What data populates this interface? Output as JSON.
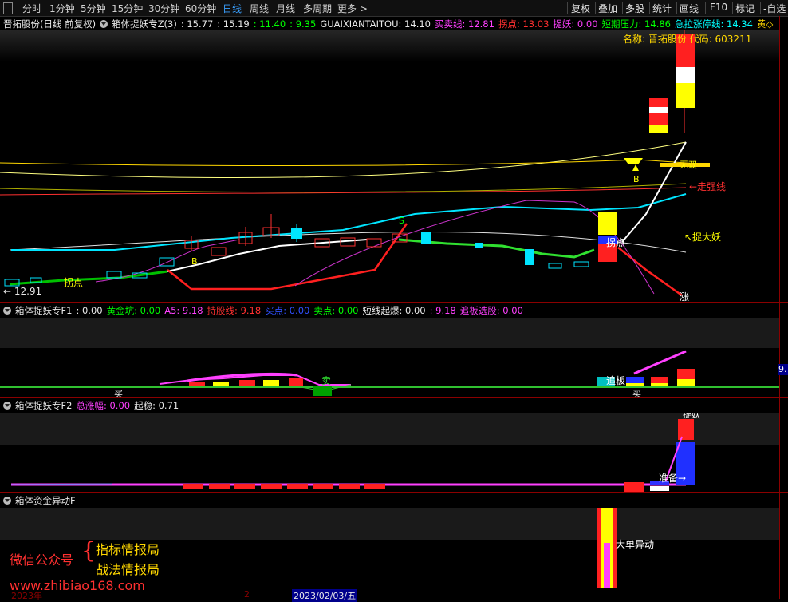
{
  "toolbar": {
    "periods": [
      "分时",
      "1分钟",
      "5分钟",
      "15分钟",
      "30分钟",
      "60分钟",
      "日线",
      "周线",
      "月线",
      "多周期",
      "更多"
    ],
    "active_period": "日线",
    "right_buttons": [
      "复权",
      "叠加",
      "多股",
      "统计",
      "画线",
      "F10",
      "标记",
      "-自选"
    ]
  },
  "main_legend": {
    "stock": "晋拓股份(日线 前复权)",
    "indicator": "箱体捉妖专Z(3)",
    "values": [
      {
        "label": "",
        "value": ": 15.77",
        "color": "#e8e8e8"
      },
      {
        "label": "",
        "value": ": 15.19",
        "color": "#e8e8e8"
      },
      {
        "label": "",
        "value": ": 11.40",
        "color": "#00ff00"
      },
      {
        "label": "",
        "value": ": 9.35",
        "color": "#00ff00"
      },
      {
        "label": "GUAIXIANTAITOU",
        "value": ": 14.10",
        "color": "#e8e8e8"
      },
      {
        "label": "买卖线",
        "value": ": 12.81",
        "color": "#ff40ff"
      },
      {
        "label": "拐点",
        "value": ": 13.03",
        "color": "#ff3030"
      },
      {
        "label": "捉妖",
        "value": ": 0.00",
        "color": "#ff40ff"
      },
      {
        "label": "短期压力",
        "value": ": 14.86",
        "color": "#00ff00"
      },
      {
        "label": "急拉涨停线",
        "value": ": 14.34",
        "color": "#00ffff"
      },
      {
        "label": "黄",
        "value": "◇",
        "color": "#ffd700"
      }
    ]
  },
  "main_chart": {
    "name_label": "名称: 晋拓股份 代码: 603211",
    "low_price": "12.91",
    "annotations": {
      "guaidian_left": "拐点",
      "B_left": "B",
      "S_mid": "S",
      "guaidian_right": "拐点",
      "B_right": "B",
      "zouqiang": "←走强线",
      "zhuoyao": "↖捉大妖",
      "zhang": "涨",
      "wushuang": "无双"
    }
  },
  "f1_legend": {
    "title": "箱体捉妖专F1",
    "values": [
      {
        "label": "",
        "value": ": 0.00",
        "color": "#e8e8e8"
      },
      {
        "label": "黄金坑",
        "value": ": 0.00",
        "color": "#00ff00"
      },
      {
        "label": "A5",
        "value": ": 9.18",
        "color": "#ff40ff"
      },
      {
        "label": "持股线",
        "value": ": 9.18",
        "color": "#ff3030"
      },
      {
        "label": "买点",
        "value": ": 0.00",
        "color": "#3050ff"
      },
      {
        "label": "卖点",
        "value": ": 0.00",
        "color": "#00ff00"
      },
      {
        "label": "短线起爆",
        "value": ": 0.00",
        "color": "#e8e8e8"
      },
      {
        "label": "",
        "value": ": 9.18",
        "color": "#ff40ff"
      },
      {
        "label": "追板选股",
        "value": ": 0.00",
        "color": "#ff40ff"
      }
    ],
    "labels": {
      "buy_left": "买",
      "sell_mid": "卖",
      "zhuiban": "追板",
      "buy_right": "买",
      "axis_value": "9."
    }
  },
  "f2_legend": {
    "title": "箱体捉妖专F2",
    "values": [
      {
        "label": "总涨幅",
        "value": ": 0.00",
        "color": "#ff40ff"
      },
      {
        "label": "起稳",
        "value": ": 0.71",
        "color": "#e8e8e8"
      }
    ],
    "labels": {
      "zhuoyao": "捉妖",
      "zhunbei": "准备→"
    }
  },
  "f3_legend": {
    "title": "箱体资金异动F",
    "labels": {
      "dadan": "大单异动"
    }
  },
  "watermark": {
    "wechat": "微信公众号",
    "line1": "指标情报局",
    "line2": "战法情报局",
    "url": "www.zhibiao168.com"
  },
  "time_axis": {
    "year": "2023年",
    "mid": "2",
    "date": "2023/02/03/五"
  },
  "colors": {
    "up": "#ff3030",
    "down": "#00e5ff",
    "bg": "#000000",
    "divider": "#8b0000"
  }
}
